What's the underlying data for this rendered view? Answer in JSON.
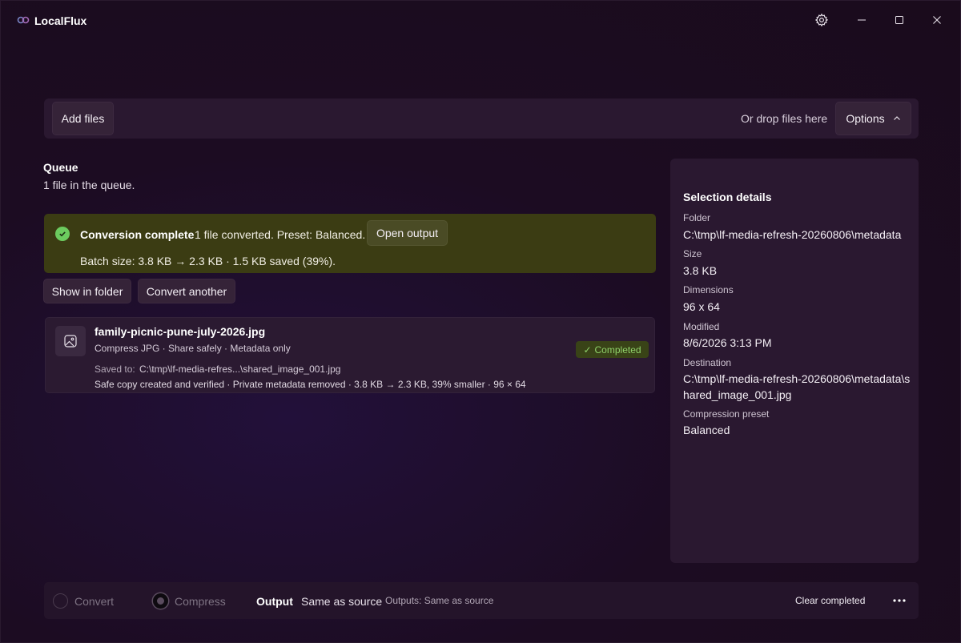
{
  "app": {
    "title": "LocalFlux"
  },
  "command_bar": {
    "add_files_label": "Add files",
    "drop_hint": "Or drop files here",
    "options_label": "Options"
  },
  "queue": {
    "title": "Queue",
    "subtitle": "1 file in the queue."
  },
  "notification": {
    "title": "Conversion complete",
    "message": "1 file converted. Preset: Balanced.",
    "open_output_label": "Open output",
    "batch": "Batch size: 3.8 KB → 2.3 KB · 1.5 KB saved (39%).",
    "color": "#3b3c13"
  },
  "actions": {
    "show_in_folder": "Show in folder",
    "convert_another": "Convert another"
  },
  "file": {
    "name": "family-picnic-pune-july-2026.jpg",
    "meta": "Compress JPG · Share safely · Metadata only",
    "saved_label": "Saved to:",
    "saved_path": "C:\\tmp\\lf-media-refres...\\shared_image_001.jpg",
    "detail": "Safe copy created and verified · Private metadata removed · 3.8 KB → 2.3 KB, 39% smaller · 96 × 64",
    "status": "Completed",
    "status_color": "#8fd16a"
  },
  "details": {
    "title": "Selection details",
    "folder_label": "Folder",
    "folder": "C:\\tmp\\lf-media-refresh-20260806\\metadata",
    "size_label": "Size",
    "size": "3.8 KB",
    "dimensions_label": "Dimensions",
    "dimensions": "96 x 64",
    "modified_label": "Modified",
    "modified": "8/6/2026 3:13 PM",
    "destination_label": "Destination",
    "destination": "C:\\tmp\\lf-media-refresh-20260806\\metadata\\shared_image_001.jpg",
    "preset_label": "Compression preset",
    "preset": "Balanced"
  },
  "bottom_bar": {
    "convert_label": "Convert",
    "compress_label": "Compress",
    "output_label": "Output",
    "output_value": "Same as source",
    "outputs_summary": "Outputs: Same as source",
    "clear_completed": "Clear completed",
    "selected_mode": "Compress"
  },
  "icons": {
    "logo": "localflux-logo-icon",
    "settings": "gear-icon",
    "minimize": "minimize-icon",
    "maximize": "maximize-icon",
    "close": "close-icon",
    "options_chevron": "chevron-up-icon",
    "success": "checkmark-circle-icon",
    "thumbnail": "image-icon",
    "more": "more-icon"
  }
}
